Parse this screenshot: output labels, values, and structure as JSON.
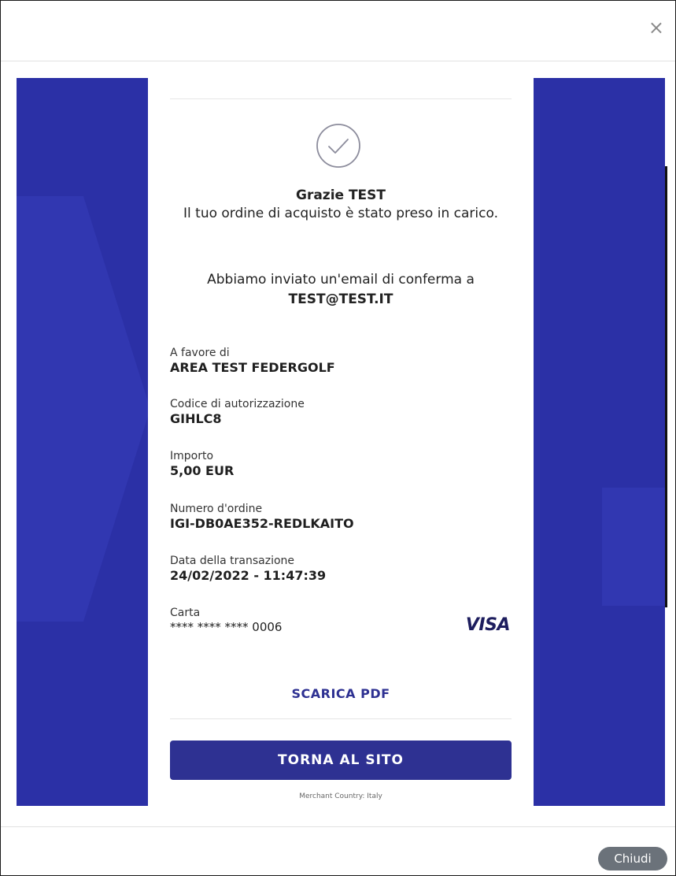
{
  "header": {
    "close_icon": "×"
  },
  "confirmation": {
    "thanks_title": "Grazie TEST",
    "thanks_message": "Il tuo ordine di acquisto è stato preso in carico.",
    "email_intro": "Abbiamo inviato un'email di conferma a",
    "email": "TEST@TEST.IT"
  },
  "details": [
    {
      "label": "A favore di",
      "value": "AREA TEST FEDERGOLF"
    },
    {
      "label": "Codice di autorizzazione",
      "value": "GIHLC8"
    },
    {
      "label": "Importo",
      "value": "5,00 EUR"
    },
    {
      "label": "Numero d'ordine",
      "value": "IGI-DB0AE352-REDLKAITO"
    },
    {
      "label": "Data della transazione",
      "value": "24/02/2022 - 11:47:39"
    }
  ],
  "card": {
    "label": "Carta",
    "number": "**** **** **** 0006",
    "brand": "VISA"
  },
  "actions": {
    "download_pdf": "SCARICA PDF",
    "back_to_site": "TORNA AL SITO"
  },
  "merchant_country": "Merchant Country: Italy",
  "footer": {
    "close_label": "Chiudi"
  },
  "colors": {
    "brand": "#2e3192",
    "background": "#2b30a6",
    "close_button": "#6b727a"
  }
}
